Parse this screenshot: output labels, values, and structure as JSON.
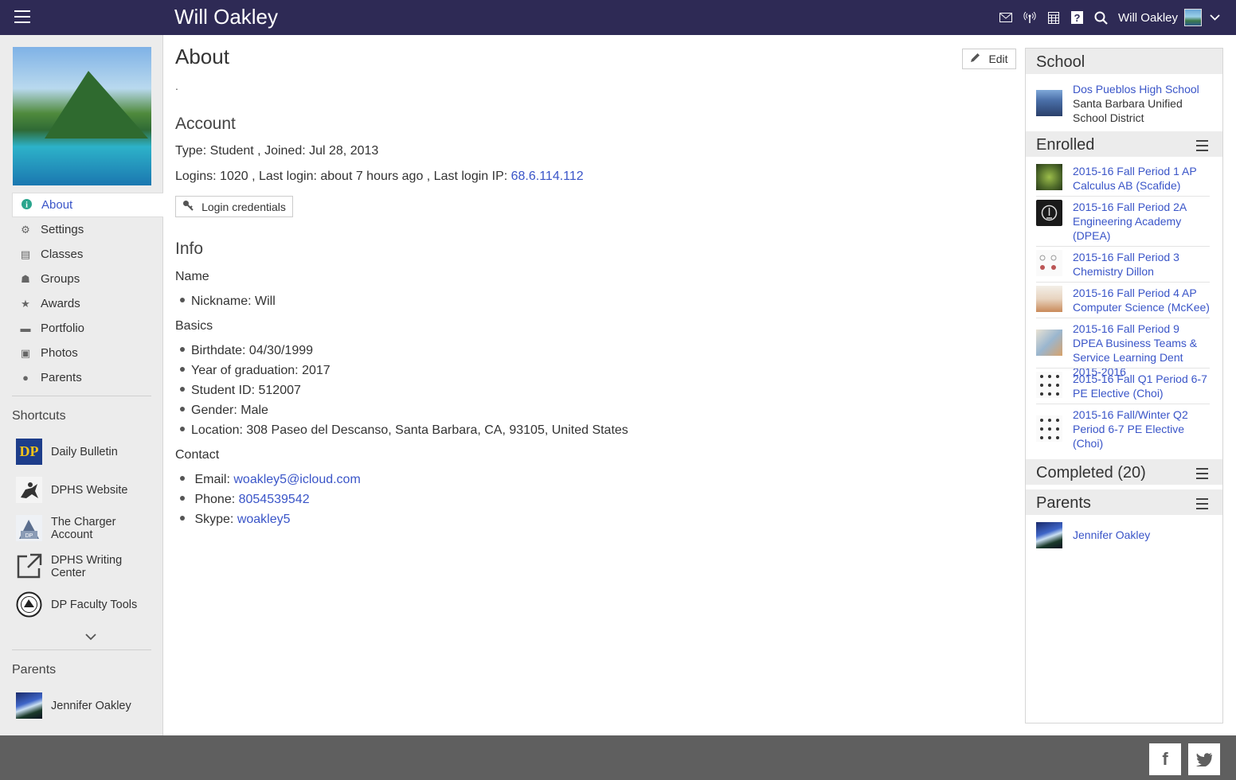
{
  "header": {
    "title": "Will Oakley",
    "user_name": "Will Oakley",
    "icons": [
      "menu-icon",
      "mail-icon",
      "signal-icon",
      "calendar-icon",
      "help-icon",
      "search-icon",
      "chevron-down-icon"
    ]
  },
  "sidebar": {
    "nav": [
      {
        "label": "About",
        "icon": "info-icon",
        "glyph": "i"
      },
      {
        "label": "Settings",
        "icon": "gear-icon",
        "glyph": "⚙"
      },
      {
        "label": "Classes",
        "icon": "book-icon",
        "glyph": "▤"
      },
      {
        "label": "Groups",
        "icon": "users-icon",
        "glyph": "☗"
      },
      {
        "label": "Awards",
        "icon": "star-icon",
        "glyph": "★"
      },
      {
        "label": "Portfolio",
        "icon": "folder-icon",
        "glyph": "▬"
      },
      {
        "label": "Photos",
        "icon": "image-icon",
        "glyph": "▣"
      },
      {
        "label": "Parents",
        "icon": "person-icon",
        "glyph": "●"
      }
    ],
    "shortcuts_heading": "Shortcuts",
    "shortcuts": [
      {
        "label": "Daily Bulletin"
      },
      {
        "label": "DPHS Website"
      },
      {
        "label": "The Charger Account"
      },
      {
        "label": "DPHS Writing Center"
      },
      {
        "label": "DP Faculty Tools"
      }
    ],
    "parents_heading": "Parents",
    "parent_name": "Jennifer Oakley"
  },
  "main": {
    "title": "About",
    "edit_label": "Edit",
    "dot": ".",
    "account_heading": "Account",
    "type_line": "Type: Student , Joined: Jul 28, 2013",
    "logins_text": "Logins: 1020 , Last login: about 7 hours ago , Last login IP: ",
    "login_ip": "68.6.114.112",
    "login_credentials_label": "Login credentials",
    "info_heading": "Info",
    "name_heading": "Name",
    "nickname": "Nickname: Will",
    "basics_heading": "Basics",
    "birthdate": "Birthdate: 04/30/1999",
    "graduation": "Year of graduation: 2017",
    "student_id": "Student ID: 512007",
    "gender": "Gender: Male",
    "location": "Location: 308 Paseo del Descanso, Santa Barbara, CA, 93105, United States",
    "contact_heading": "Contact",
    "email_label": "Email: ",
    "email": "woakley5@icloud.com",
    "phone_label": "Phone: ",
    "phone": "8054539542",
    "skype_label": "Skype: ",
    "skype": "woakley5"
  },
  "right": {
    "school_heading": "School",
    "school_name": "Dos Pueblos High School",
    "school_district": "Santa Barbara Unified School District",
    "enrolled_heading": "Enrolled",
    "courses": [
      "2015-16 Fall Period 1 AP Calculus AB (Scafide)",
      "2015-16 Fall Period 2A Engineering Academy (DPEA)",
      "2015-16 Fall Period 3 Chemistry Dillon",
      "2015-16 Fall Period 4 AP Computer Science (McKee)",
      "2015-16 Fall Period 9 DPEA Business Teams & Service Learning Dent 2015-2016",
      "2015-16 Fall Q1 Period 6-7 PE Elective (Choi)",
      "2015-16 Fall/Winter Q2 Period 6-7 PE Elective (Choi)"
    ],
    "completed_heading": "Completed (20)",
    "parents_heading": "Parents",
    "parent_name": "Jennifer Oakley"
  },
  "footer": {
    "facebook": "f",
    "twitter": "t"
  },
  "colors": {
    "topbar": "#2e2a55",
    "link": "#3a55c8",
    "footer": "#5f5f5f"
  }
}
